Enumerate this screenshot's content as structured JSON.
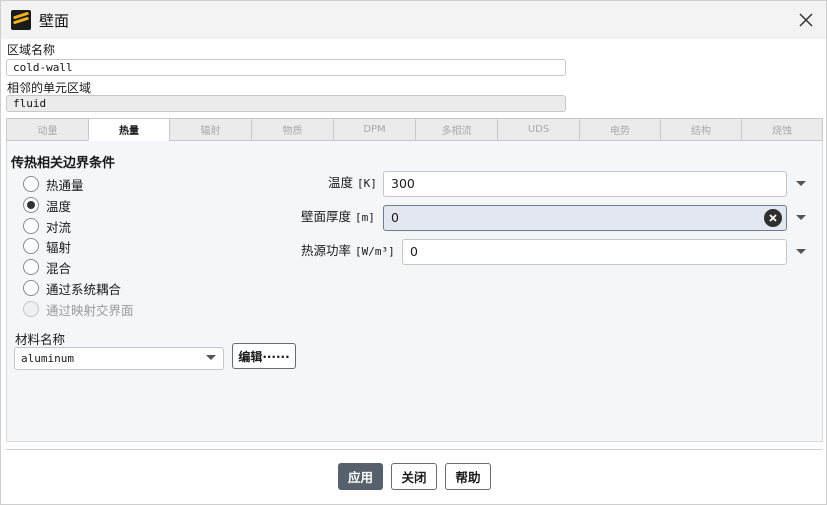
{
  "window": {
    "title": "壁面"
  },
  "zone": {
    "name_label": "区域名称",
    "name_value": "cold-wall",
    "adjacent_label": "相邻的单元区域",
    "adjacent_value": "fluid"
  },
  "tabs": [
    {
      "label": "动量",
      "state": "enabled"
    },
    {
      "label": "热量",
      "state": "active"
    },
    {
      "label": "辐射",
      "state": "enabled"
    },
    {
      "label": "物质",
      "state": "disabled"
    },
    {
      "label": "DPM",
      "state": "disabled"
    },
    {
      "label": "多相流",
      "state": "disabled"
    },
    {
      "label": "UDS",
      "state": "disabled"
    },
    {
      "label": "电势",
      "state": "disabled"
    },
    {
      "label": "结构",
      "state": "disabled"
    },
    {
      "label": "烧蚀",
      "state": "disabled"
    }
  ],
  "thermal": {
    "section_title": "传热相关边界条件",
    "options": [
      {
        "label": "热通量",
        "checked": false,
        "disabled": false
      },
      {
        "label": "温度",
        "checked": true,
        "disabled": false
      },
      {
        "label": "对流",
        "checked": false,
        "disabled": false
      },
      {
        "label": "辐射",
        "checked": false,
        "disabled": false
      },
      {
        "label": "混合",
        "checked": false,
        "disabled": false
      },
      {
        "label": "通过系统耦合",
        "checked": false,
        "disabled": false
      },
      {
        "label": "通过映射交界面",
        "checked": false,
        "disabled": true
      }
    ],
    "temperature": {
      "label": "温度",
      "unit": "[K]",
      "value": "300"
    },
    "wall_thickness": {
      "label": "壁面厚度",
      "unit": "[m]",
      "value": "0"
    },
    "heat_source": {
      "label": "热源功率",
      "unit": "[W/m³]",
      "value": "0"
    }
  },
  "material": {
    "label": "材料名称",
    "value": "aluminum",
    "edit_label": "编辑······"
  },
  "buttons": {
    "apply": "应用",
    "close": "关闭",
    "help": "帮助"
  },
  "colors": {
    "primary_button": "#56616c",
    "focused_input": "#e3e8f0",
    "app_icon_accent": "#f2b21c"
  }
}
